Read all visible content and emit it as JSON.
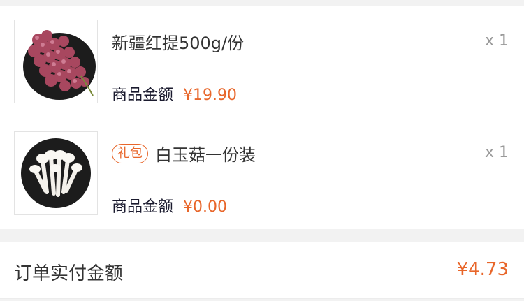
{
  "items": [
    {
      "name": "新疆红提500g/份",
      "tag": "",
      "qty": "x 1",
      "price_label": "商品金额",
      "price": "¥19.90"
    },
    {
      "name": "白玉菇一份装",
      "tag": "礼包",
      "qty": "x 1",
      "price_label": "商品金额",
      "price": "¥0.00"
    }
  ],
  "summary": {
    "label": "订单实付金额",
    "amount": "¥4.73"
  },
  "colors": {
    "accent": "#e8662a",
    "text": "#333333",
    "muted": "#999999",
    "background": "#f2f2f2"
  },
  "icons": [
    "grape-product-image",
    "mushroom-product-image"
  ]
}
